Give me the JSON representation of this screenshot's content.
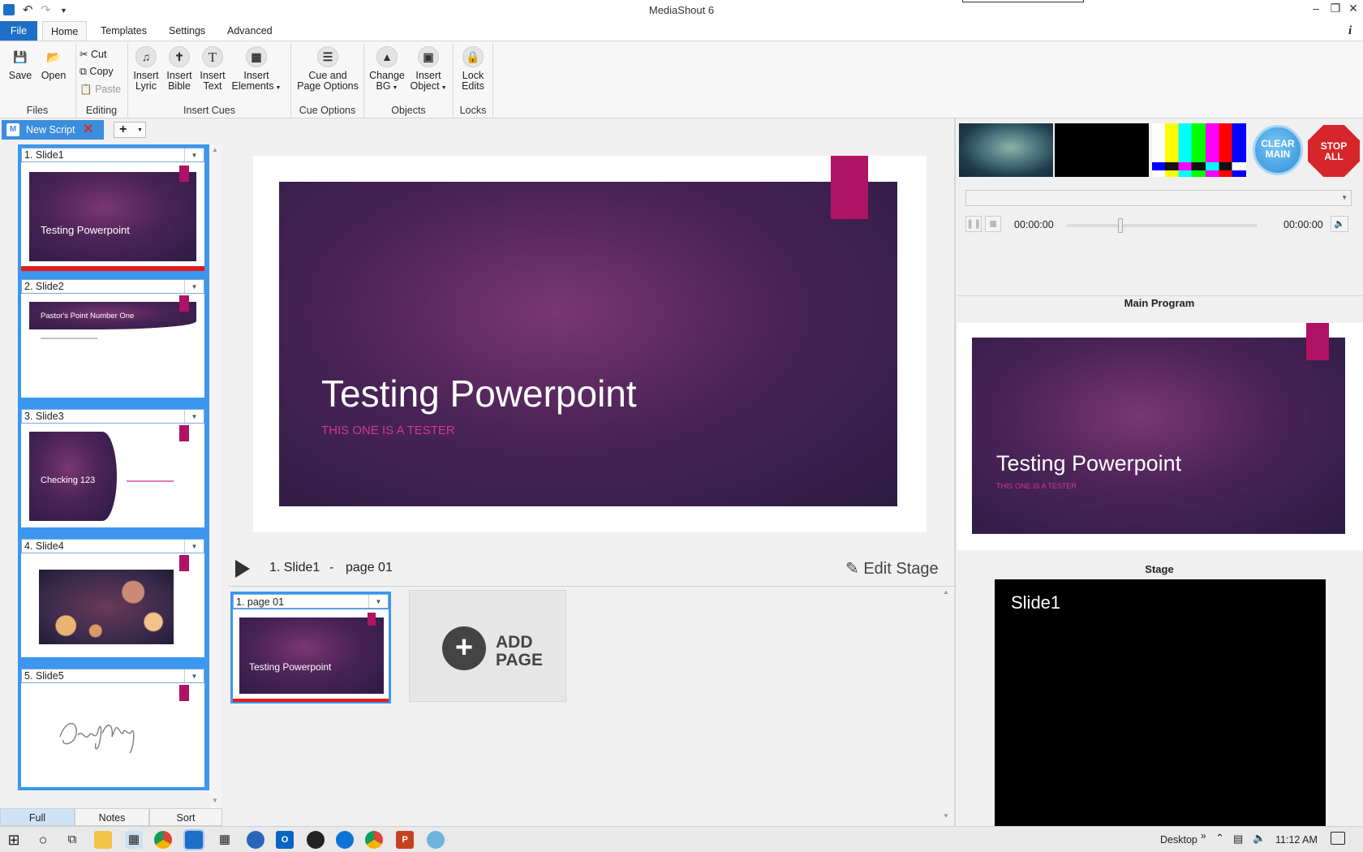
{
  "window": {
    "title": "MediaShout 6",
    "minimize": "‒",
    "restore": "❐",
    "close": "✕"
  },
  "tabs": {
    "file": "File",
    "home": "Home",
    "templates": "Templates",
    "settings": "Settings",
    "advanced": "Advanced",
    "info": "i"
  },
  "ribbon": {
    "save": "Save",
    "open": "Open",
    "files_group": "Files",
    "cut": "Cut",
    "copy": "Copy",
    "paste": "Paste",
    "editing_group": "Editing",
    "insert_lyric_1": "Insert",
    "insert_lyric_2": "Lyric",
    "insert_bible_1": "Insert",
    "insert_bible_2": "Bible",
    "insert_text_1": "Insert",
    "insert_text_2": "Text",
    "insert_elements_1": "Insert",
    "insert_elements_2": "Elements",
    "insert_cues_group": "Insert Cues",
    "cue_page_1": "Cue and",
    "cue_page_2": "Page Options",
    "cue_options_group": "Cue Options",
    "change_bg_1": "Change",
    "change_bg_2": "BG",
    "insert_object_1": "Insert",
    "insert_object_2": "Object",
    "objects_group": "Objects",
    "lock_edits_1": "Lock",
    "lock_edits_2": "Edits",
    "locks_group": "Locks"
  },
  "doc_tab": {
    "label": "New Script",
    "add": "+"
  },
  "slides": [
    {
      "header": "1. Slide1",
      "thumb_title": "Testing Powerpoint"
    },
    {
      "header": "2. Slide2",
      "thumb_title": "Pastor's Point Number One"
    },
    {
      "header": "3. Slide3",
      "thumb_title": "Checking 123"
    },
    {
      "header": "4. Slide4"
    },
    {
      "header": "5. Slide5"
    }
  ],
  "bottom_tabs": {
    "full": "Full",
    "notes": "Notes",
    "sort": "Sort"
  },
  "main_slide": {
    "title": "Testing Powerpoint",
    "subtitle": "THIS ONE IS A TESTER"
  },
  "playbar": {
    "slide": "1. Slide1",
    "dash": "-",
    "page": "page 01",
    "edit_stage": "Edit Stage"
  },
  "pages": [
    {
      "header": "1. page 01",
      "thumb_title": "Testing Powerpoint"
    }
  ],
  "add_page": {
    "line1": "ADD",
    "line2": "PAGE"
  },
  "right_panel": {
    "clear_main_1": "CLEAR",
    "clear_main_2": "MAIN",
    "stop_all_1": "STOP",
    "stop_all_2": "ALL",
    "time_start": "00:00:00",
    "time_end": "00:00:00",
    "main_program_label": "Main Program",
    "program_title": "Testing Powerpoint",
    "program_subtitle": "THIS ONE IS A TESTER",
    "stage_label": "Stage",
    "stage_text": "Slide1"
  },
  "taskbar": {
    "desktop": "Desktop",
    "chevron": "»",
    "time": "11:12 AM"
  },
  "colors": {
    "accent": "#3b8ddd",
    "file_tab": "#1e6fc8",
    "tag": "#b01265",
    "red": "#e21c1c"
  }
}
